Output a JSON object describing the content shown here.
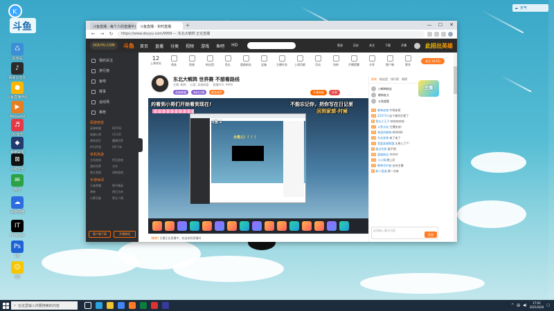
{
  "desktop": {
    "logo_text": "斗鱼",
    "weather_text": "天气",
    "icons": [
      {
        "label": "回收站"
      },
      {
        "label": "网易云音乐"
      },
      {
        "label": "斗鱼直播伴侣"
      },
      {
        "label": "WeGame"
      },
      {
        "label": "2021-01-25"
      },
      {
        "label": "QQ音乐"
      },
      {
        "label": "英雄联盟"
      },
      {
        "label": "火绒安全"
      },
      {
        "label": "腾讯视频"
      },
      {
        "label": "网易UU加速器"
      },
      {
        "label": "微信"
      },
      {
        "label": "百度网盘"
      },
      {
        "label": "IT home"
      },
      {
        "label": "PS"
      },
      {
        "label": "QQ"
      }
    ]
  },
  "browser": {
    "tabs": [
      "斗鱼直播 - 每个人的直播平台",
      "斗鱼直播 - 实时直播"
    ],
    "window_controls": [
      "—",
      "☐",
      "✕"
    ],
    "url": "https://www.douyu.com/9999 — 东北大鹌鹑 正在直播",
    "nav_icons": [
      "←",
      "→",
      "↻"
    ]
  },
  "douyu": {
    "logo": "DOUYU.COM",
    "brand": "斗鱼",
    "nav": [
      "首页",
      "直播",
      "分类",
      "视频",
      "游戏",
      "鱼吧",
      "HD"
    ],
    "header_right": [
      "登录",
      "历史",
      "关注",
      "下载",
      "开播",
      "消息"
    ],
    "ad_text": "此招出英雄",
    "sidebar": {
      "items": [
        "我的关注",
        "排行榜",
        "鱼吧",
        "赛事",
        "运动场",
        "推荐"
      ],
      "sections": [
        {
          "heading": "网游竞技",
          "games": [
            "英雄联盟",
            "DOTA2",
            "穿越火线",
            "CS:GO",
            "绝地求生",
            "魔兽世界",
            "炉石传说",
            "QQ飞车"
          ]
        },
        {
          "heading": "单机热游",
          "games": [
            "主机游戏",
            "怀旧游戏",
            "我的世界",
            "方舟",
            "独立游戏",
            "恐怖游戏"
          ]
        },
        {
          "heading": "手游休闲",
          "games": [
            "王者荣耀",
            "和平精英",
            "原神",
            "明日方舟",
            "火影忍者",
            "第五人格"
          ]
        }
      ],
      "bottom_buttons": [
        "客户端下载",
        "开播教程"
      ]
    },
    "categories": [
      {
        "label": "上周排名",
        "value": "12"
      },
      {
        "label": "贵族"
      },
      {
        "label": "鱼翅"
      },
      {
        "label": "粉丝团"
      },
      {
        "label": "鱼丸"
      },
      {
        "label": "超级粉丝"
      },
      {
        "label": "宝箱"
      },
      {
        "label": "主播任务"
      },
      {
        "label": "上周贡献"
      },
      {
        "label": "活动"
      },
      {
        "label": "钻粉"
      },
      {
        "label": "开播提醒"
      },
      {
        "label": "分享"
      },
      {
        "label": "客户端"
      },
      {
        "label": "更多"
      }
    ],
    "follow_button": "关注 16.0万",
    "streamer": {
      "title": "东北大鹌鹑 世界赛 不想看路线",
      "meta": [
        "主播: 鹌鹑",
        "分类: 英雄联盟",
        "直播间号: 9999"
      ],
      "tags": [
        "英雄联盟",
        "有料主播",
        "职业选手"
      ],
      "side_buttons": [
        "开通贵族",
        "分享"
      ]
    },
    "video": {
      "overlay_left": "的看到小哥们开始看到现在!",
      "overlay_right": "不能忘记你，把你写在日记里",
      "overlay_sub": "回到家想-时候",
      "inner_title": "斗鱼 2",
      "inner_msg": "太卷儿！！！！"
    },
    "below_video": {
      "tag": "[鹌鹑]",
      "text": "主播正在直播中，欢迎来到直播间"
    },
    "chat": {
      "tabs": [
        "贵宾",
        "粉丝团",
        "排行榜",
        "周榜"
      ],
      "badge": "主播",
      "ranks": [
        {
          "name": "小鹌鹑粉丝"
        },
        {
          "name": "鹌鹑老大"
        },
        {
          "name": "斗鱼超管"
        }
      ],
      "lines": [
        {
          "level": "12",
          "name": "鹌鹑老铁:",
          "text": "牛啊老哥"
        },
        {
          "level": "25",
          "name": "ZZ0710:",
          "text": "这个操作厉害了"
        },
        {
          "level": "8",
          "name": "鱼丸小王子:",
          "text": "哈哈哈哈哈"
        },
        {
          "level": "17",
          "name": "斗鱼水友:",
          "text": "主播加油！"
        },
        {
          "level": "31",
          "name": "夜里的鹌鹑:",
          "text": "666666"
        },
        {
          "level": "14",
          "name": "东北老铁:",
          "text": "来了来了"
        },
        {
          "level": "22",
          "name": "我爱英雄联盟:",
          "text": "太卷儿了!!!"
        },
        {
          "level": "9",
          "name": "路过的鱼:",
          "text": "真不错"
        },
        {
          "level": "40",
          "name": "超级粉丝:",
          "text": "冲冲冲"
        },
        {
          "level": "11",
          "name": "小火锅:",
          "text": "晚上好"
        },
        {
          "level": "19",
          "name": "鹌鹑守护者:",
          "text": "支持主播"
        },
        {
          "level": "6",
          "name": "新人报道:",
          "text": "第一次来"
        }
      ],
      "input_placeholder": "这里输入聊天内容",
      "send_label": "发送"
    }
  },
  "taskbar": {
    "search_placeholder": "在这里输入你要搜索的内容",
    "time": "17:02",
    "date": "2021/9/26"
  },
  "colors": {
    "accent": "#ff6a00",
    "sidebar": "#2d2f33",
    "taskbar": "#1c2c3c"
  }
}
